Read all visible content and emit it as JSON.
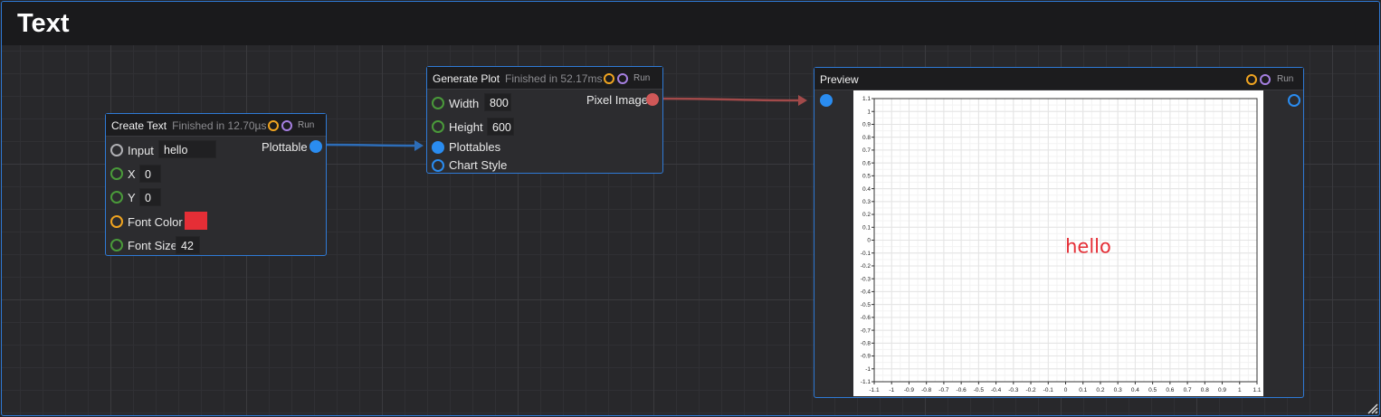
{
  "window": {
    "title": "Text"
  },
  "nodes": {
    "create_text": {
      "title": "Create Text",
      "status": "Finished in 12.70µs",
      "run_label": "Run",
      "inputs": [
        {
          "label": "Input",
          "value": "hello"
        },
        {
          "label": "X",
          "value": "0"
        },
        {
          "label": "Y",
          "value": "0"
        },
        {
          "label": "Font Color",
          "value": "#e52e36"
        },
        {
          "label": "Font Size",
          "value": "42"
        }
      ],
      "output_label": "Plottable"
    },
    "generate_plot": {
      "title": "Generate Plot",
      "status": "Finished in 52.17ms",
      "run_label": "Run",
      "inputs": [
        {
          "label": "Width",
          "value": "800"
        },
        {
          "label": "Height",
          "value": "600"
        },
        {
          "label": "Plottables"
        },
        {
          "label": "Chart Style"
        }
      ],
      "output_label": "Pixel Image"
    },
    "preview": {
      "title": "Preview",
      "run_label": "Run"
    }
  },
  "colors": {
    "accent": "#2f7ad6",
    "port_blue": "#2a8cf0",
    "port_red": "#d05858",
    "port_green": "#4a9a3a",
    "port_orange": "#f0a420",
    "port_purple": "#a57fe0",
    "font_color": "#e52e36"
  },
  "chart_data": {
    "type": "scatter",
    "x_ticks": [
      "-1.1",
      "-1",
      "-0.9",
      "-0.8",
      "-0.7",
      "-0.6",
      "-0.5",
      "-0.4",
      "-0.3",
      "-0.2",
      "-0.1",
      "0",
      "0.1",
      "0.2",
      "0.3",
      "0.4",
      "0.5",
      "0.6",
      "0.7",
      "0.8",
      "0.9",
      "1",
      "1.1"
    ],
    "y_ticks": [
      "1.1",
      "1",
      "0.9",
      "0.8",
      "0.7",
      "0.6",
      "0.5",
      "0.4",
      "0.3",
      "0.2",
      "0.1",
      "0",
      "-0.1",
      "-0.2",
      "-0.3",
      "-0.4",
      "-0.5",
      "-0.6",
      "-0.7",
      "-0.8",
      "-0.9",
      "-1",
      "-1.1"
    ],
    "xlim": [
      -1.1,
      1.1
    ],
    "ylim": [
      -1.1,
      1.1
    ],
    "grid": true,
    "annotations": [
      {
        "text": "hello",
        "x": 0.13,
        "y": -0.1,
        "color": "#e52e36"
      }
    ]
  }
}
